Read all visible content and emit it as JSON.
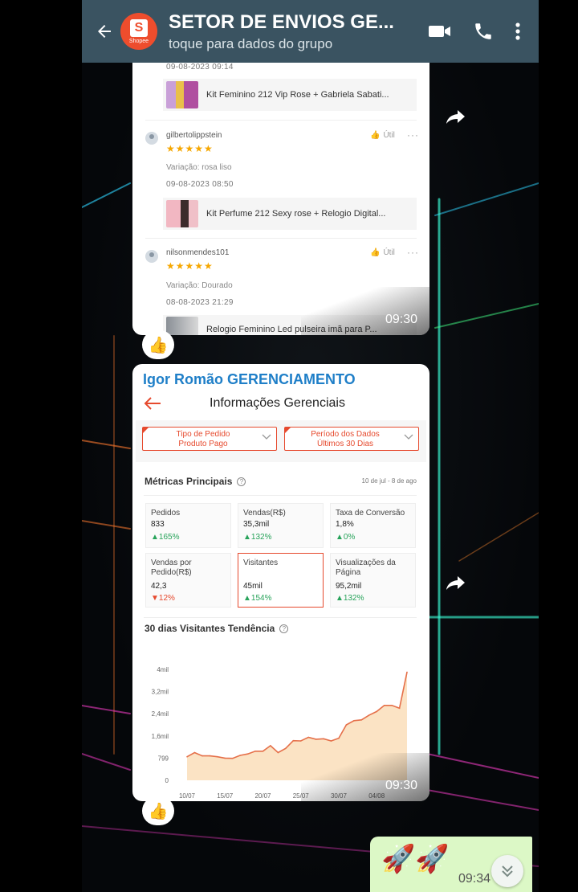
{
  "header": {
    "title": "SETOR DE ENVIOS GE...",
    "subtitle": "toque para dados do grupo",
    "avatar_brand": "Shopee",
    "avatar_letter": "S",
    "icons": [
      "arrow-left-icon",
      "video-call-icon",
      "phone-icon",
      "more-vertical-icon"
    ]
  },
  "messages": [
    {
      "time": "09:30",
      "reaction": "👍",
      "reviews": [
        {
          "date": "09-08-2023 09:14",
          "product": "Kit Feminino 212 Vip Rose + Gabriela Sabati..."
        },
        {
          "user": "gilbertolippstein",
          "stars": "★★★★★",
          "variation": "Variação: rosa liso",
          "date": "09-08-2023 08:50",
          "product": "Kit Perfume 212 Sexy rose + Relogio Digital...",
          "useful": "Útil"
        },
        {
          "user": "nilsonmendes101",
          "stars": "★★★★★",
          "variation": "Variação: Dourado",
          "date": "08-08-2023 21:29",
          "product": "Relogio Feminino Led pulseira imã para P...",
          "useful": "Útil"
        }
      ]
    },
    {
      "sender": "Igor Romão GERENCIAMENTO",
      "time": "09:30",
      "reaction": "👍",
      "screen_title": "Informações Gerenciais",
      "filters": [
        {
          "line1": "Tipo de Pedido",
          "line2": "Produto Pago"
        },
        {
          "line1": "Período dos Dados",
          "line2": "Últimos 30 Dias"
        }
      ],
      "metrics_title": "Métricas Principais",
      "date_range": "10 de jul - 8 de ago",
      "metrics": [
        {
          "label": "Pedidos",
          "value": "833",
          "change": "▲165%",
          "dir": "up"
        },
        {
          "label": "Vendas(R$)",
          "value": "35,3mil",
          "change": "▲132%",
          "dir": "up"
        },
        {
          "label": "Taxa de Conversão",
          "value": "1,8%",
          "change": "▲0%",
          "dir": "up"
        },
        {
          "label": "Vendas por Pedido(R$)",
          "value": "42,3",
          "change": "▼12%",
          "dir": "down"
        },
        {
          "label": "Visitantes",
          "value": "45mil",
          "change": "▲154%",
          "dir": "up"
        },
        {
          "label": "Visualizações da Página",
          "value": "95,2mil",
          "change": "▲132%",
          "dir": "up"
        }
      ],
      "chart_title": "30 dias Visitantes Tendência"
    },
    {
      "text": "🚀🚀",
      "time": "09:34"
    }
  ],
  "chart_data": {
    "type": "area",
    "title": "30 dias Visitantes Tendência",
    "y_ticks": [
      "0",
      "799",
      "1,6mil",
      "2,4mil",
      "3,2mil",
      "4mil"
    ],
    "y_tick_values": [
      0,
      799,
      1600,
      2400,
      3200,
      4000
    ],
    "x_ticks": [
      "10/07",
      "15/07",
      "20/07",
      "25/07",
      "30/07",
      "04/08"
    ],
    "ylim": [
      0,
      4000
    ],
    "x": [
      "10/07",
      "11/07",
      "12/07",
      "13/07",
      "14/07",
      "15/07",
      "16/07",
      "17/07",
      "18/07",
      "19/07",
      "20/07",
      "21/07",
      "22/07",
      "23/07",
      "24/07",
      "25/07",
      "26/07",
      "27/07",
      "28/07",
      "29/07",
      "30/07",
      "31/07",
      "01/08",
      "02/08",
      "03/08",
      "04/08",
      "05/08",
      "06/08",
      "07/08",
      "08/08"
    ],
    "values": [
      850,
      1000,
      880,
      880,
      850,
      800,
      790,
      900,
      950,
      1050,
      1050,
      1250,
      1000,
      1150,
      1430,
      1420,
      1550,
      1480,
      1500,
      1420,
      1520,
      2000,
      2150,
      2180,
      2350,
      2480,
      2700,
      2700,
      2600,
      3900
    ],
    "line_color": "#e5704a",
    "fill_color": "#fbe3c4",
    "grid": false
  }
}
